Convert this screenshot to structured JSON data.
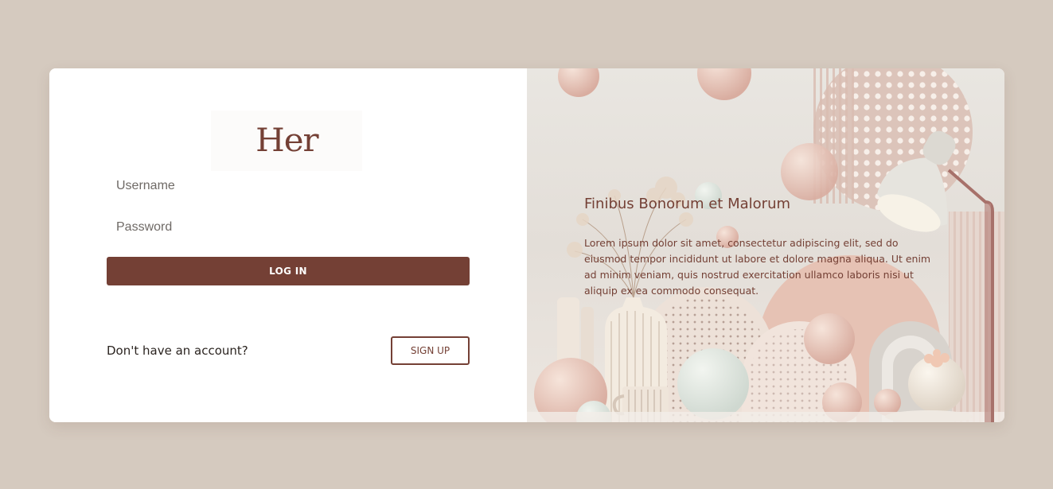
{
  "brand": {
    "logo_text": "Her",
    "accent_color": "#744035",
    "background_color": "#d5cabf"
  },
  "login_form": {
    "username_placeholder": "Username",
    "password_placeholder": "Password",
    "login_label": "LOG IN"
  },
  "signup": {
    "prompt": "Don't have an account?",
    "button_label": "SIGN UP"
  },
  "hero": {
    "title": "Finibus Bonorum et Malorum",
    "body": "Lorem ipsum dolor sit amet, consectetur adipiscing elit, sed do eiusmod tempor incididunt ut labore et dolore magna aliqua. Ut enim ad minim veniam, quis nostrud exercitation ullamco laboris nisi ut aliquip ex ea commodo consequat."
  }
}
